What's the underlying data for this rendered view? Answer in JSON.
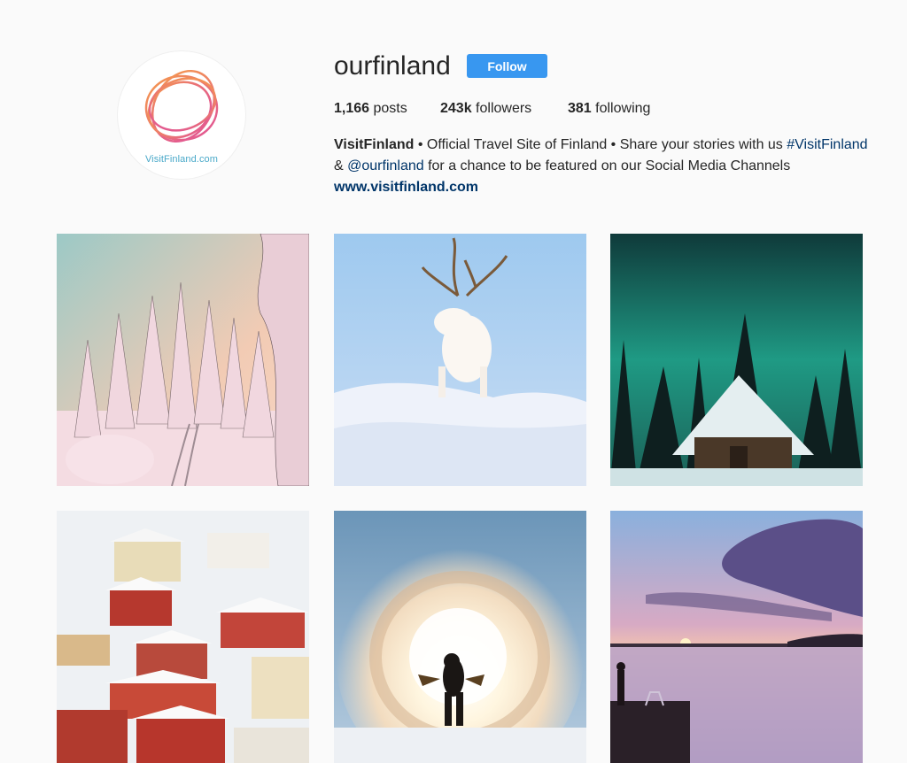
{
  "profile": {
    "username": "ourfinland",
    "follow_label": "Follow",
    "avatar_text": "VisitFinland.com",
    "stats": {
      "posts_count": "1,166",
      "posts_label": "posts",
      "followers_count": "243k",
      "followers_label": "followers",
      "following_count": "381",
      "following_label": "following"
    },
    "bio": {
      "name": "VisitFinland",
      "line1_rest": " • Official Travel Site of Finland • Share your stories with us ",
      "hashtag": "#VisitFinland",
      "line2_start": "& ",
      "mention": "@ourfinland",
      "line2_rest": " for a chance to be featured on our Social Media Channels",
      "website": "www.visitfinland.com"
    }
  },
  "posts": [
    {
      "subject": "snowy forest trees"
    },
    {
      "subject": "white reindeer in snow"
    },
    {
      "subject": "northern lights over snowy cabin"
    },
    {
      "subject": "snowy town houses"
    },
    {
      "subject": "person throwing hot water in frost"
    },
    {
      "subject": "sunset over lake with pier"
    }
  ],
  "colors": {
    "follow_button": "#3897f0",
    "link": "#003569",
    "background": "#fafafa"
  }
}
